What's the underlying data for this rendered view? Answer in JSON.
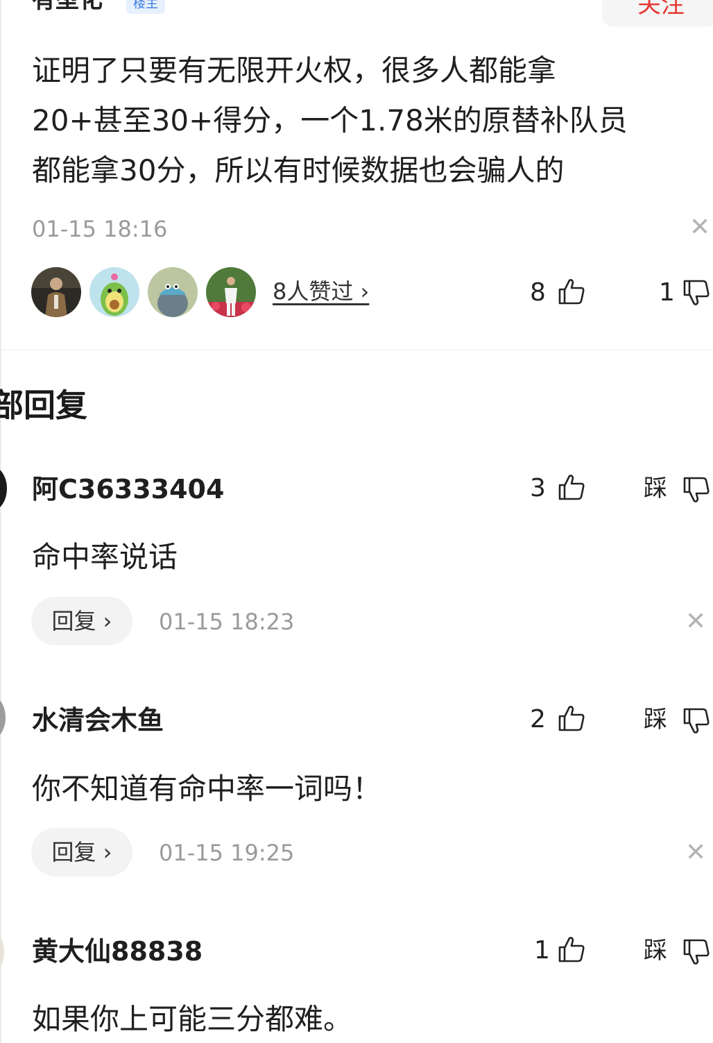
{
  "main_comment": {
    "author": "有型化",
    "badge": "楼主",
    "follow_label": "关注",
    "text": "证明了只要有无限开火权，很多人都能拿\n20+甚至30+得分，一个1.78米的原替补队员\n都能拿30分，所以有时候数据也会骗人的",
    "time": "01-15 18:16",
    "likers_text": "8人赞过 ›",
    "like_count": "8",
    "dislike_count": "1"
  },
  "section": {
    "title": "部回复"
  },
  "replies": [
    {
      "name": "阿C36333404",
      "text": "命中率说话",
      "time": "01-15 18:23",
      "likes": "3",
      "dislike_label": "踩",
      "reply_label": "回复 ›"
    },
    {
      "name": "水清会木鱼",
      "text": "你不知道有命中率一词吗！",
      "time": "01-15 19:25",
      "likes": "2",
      "dislike_label": "踩",
      "reply_label": "回复 ›"
    },
    {
      "name": "黄大仙88838",
      "text": "如果你上可能三分都难。",
      "likes": "1",
      "dislike_label": "踩"
    }
  ],
  "icons": {
    "like": "thumbs-up-icon",
    "dislike": "thumbs-down-icon",
    "close": "close-icon"
  },
  "colors": {
    "follow": "#e53935",
    "badge_bg": "#e7f0fd",
    "badge_text": "#3a7de0",
    "muted": "#9a9a9a"
  }
}
